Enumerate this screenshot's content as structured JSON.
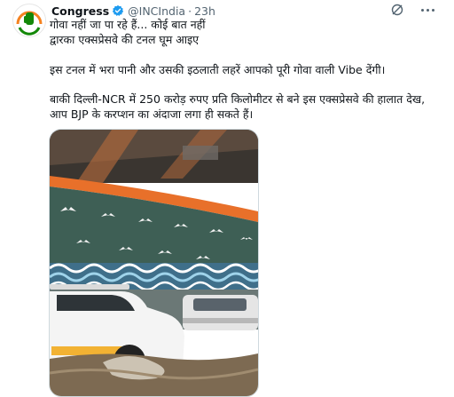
{
  "tweet": {
    "author_name": "Congress",
    "handle": "@INCIndia",
    "separator": "·",
    "time": "23h",
    "lines": [
      "गोवा नहीं जा पा रहे हैं... कोई बात नहीं",
      "द्वारका एक्सप्रेसवे की टनल घूम आइए",
      "इस टनल में भरा पानी और उसकी इठलाती लहरें आपको पूरी गोवा वाली Vibe देंगी।",
      "बाकी दिल्ली-NCR में 250 करोड़ रुपए प्रति किलोमीटर से बने इस एक्सप्रेसवे की हालात देख,",
      "आप BJP के करप्शन का अंदाजा लगा ही सकते हैं।"
    ]
  },
  "colors": {
    "text_primary": "#0f1419",
    "text_secondary": "#536471",
    "verified_blue": "#1d9bf0",
    "congress_saffron": "#f58220",
    "congress_green": "#138808"
  },
  "icons": {
    "verified": "verified-badge-icon",
    "grok": "grok-icon",
    "more": "more-options-icon"
  }
}
